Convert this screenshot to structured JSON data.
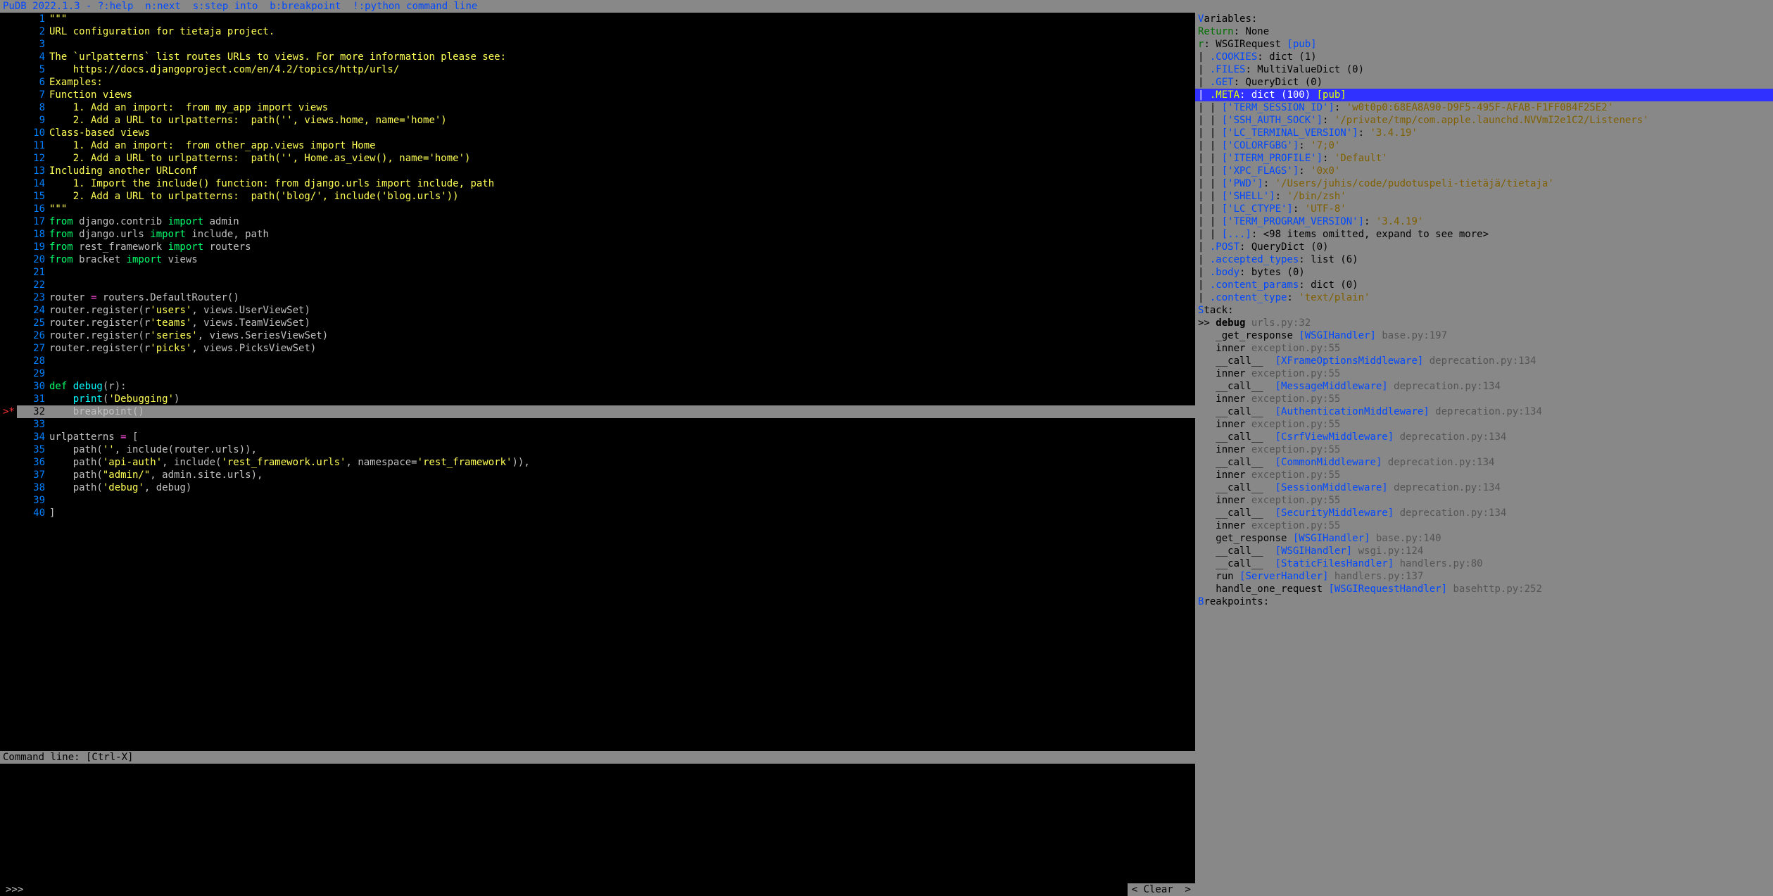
{
  "header": {
    "title": "PuDB 2022.1.3 - ",
    "hints": "?:help  n:next  s:step into  b:breakpoint  !:python command line"
  },
  "code": {
    "current_line": 32,
    "lines": [
      {
        "n": 1,
        "tokens": [
          {
            "c": "s-str",
            "t": "\"\"\""
          }
        ]
      },
      {
        "n": 2,
        "tokens": [
          {
            "c": "s-str",
            "t": "URL configuration for tietaja project."
          }
        ]
      },
      {
        "n": 3,
        "tokens": []
      },
      {
        "n": 4,
        "tokens": [
          {
            "c": "s-str",
            "t": "The `urlpatterns` list routes URLs to views. For more information please see:"
          }
        ]
      },
      {
        "n": 5,
        "tokens": [
          {
            "c": "s-str",
            "t": "    https://docs.djangoproject.com/en/4.2/topics/http/urls/"
          }
        ]
      },
      {
        "n": 6,
        "tokens": [
          {
            "c": "s-str",
            "t": "Examples:"
          }
        ]
      },
      {
        "n": 7,
        "tokens": [
          {
            "c": "s-str",
            "t": "Function views"
          }
        ]
      },
      {
        "n": 8,
        "tokens": [
          {
            "c": "s-str",
            "t": "    1. Add an import:  from my_app import views"
          }
        ]
      },
      {
        "n": 9,
        "tokens": [
          {
            "c": "s-str",
            "t": "    2. Add a URL to urlpatterns:  path('', views.home, name='home')"
          }
        ]
      },
      {
        "n": 10,
        "tokens": [
          {
            "c": "s-str",
            "t": "Class-based views"
          }
        ]
      },
      {
        "n": 11,
        "tokens": [
          {
            "c": "s-str",
            "t": "    1. Add an import:  from other_app.views import Home"
          }
        ]
      },
      {
        "n": 12,
        "tokens": [
          {
            "c": "s-str",
            "t": "    2. Add a URL to urlpatterns:  path('', Home.as_view(), name='home')"
          }
        ]
      },
      {
        "n": 13,
        "tokens": [
          {
            "c": "s-str",
            "t": "Including another URLconf"
          }
        ]
      },
      {
        "n": 14,
        "tokens": [
          {
            "c": "s-str",
            "t": "    1. Import the include() function: from django.urls import include, path"
          }
        ]
      },
      {
        "n": 15,
        "tokens": [
          {
            "c": "s-str",
            "t": "    2. Add a URL to urlpatterns:  path('blog/', include('blog.urls'))"
          }
        ]
      },
      {
        "n": 16,
        "tokens": [
          {
            "c": "s-str",
            "t": "\"\"\""
          }
        ]
      },
      {
        "n": 17,
        "tokens": [
          {
            "c": "s-kw",
            "t": "from"
          },
          {
            "c": "s-plain",
            "t": " django.contrib "
          },
          {
            "c": "s-kw",
            "t": "import"
          },
          {
            "c": "s-plain",
            "t": " admin"
          }
        ]
      },
      {
        "n": 18,
        "tokens": [
          {
            "c": "s-kw",
            "t": "from"
          },
          {
            "c": "s-plain",
            "t": " django.urls "
          },
          {
            "c": "s-kw",
            "t": "import"
          },
          {
            "c": "s-plain",
            "t": " include, path"
          }
        ]
      },
      {
        "n": 19,
        "tokens": [
          {
            "c": "s-kw",
            "t": "from"
          },
          {
            "c": "s-plain",
            "t": " rest_framework "
          },
          {
            "c": "s-kw",
            "t": "import"
          },
          {
            "c": "s-plain",
            "t": " routers"
          }
        ]
      },
      {
        "n": 20,
        "tokens": [
          {
            "c": "s-kw",
            "t": "from"
          },
          {
            "c": "s-plain",
            "t": " bracket "
          },
          {
            "c": "s-kw",
            "t": "import"
          },
          {
            "c": "s-plain",
            "t": " views"
          }
        ]
      },
      {
        "n": 21,
        "tokens": []
      },
      {
        "n": 22,
        "tokens": []
      },
      {
        "n": 23,
        "tokens": [
          {
            "c": "s-plain",
            "t": "router "
          },
          {
            "c": "s-op",
            "t": "="
          },
          {
            "c": "s-plain",
            "t": " routers.DefaultRouter()"
          }
        ]
      },
      {
        "n": 24,
        "tokens": [
          {
            "c": "s-plain",
            "t": "router.register(r"
          },
          {
            "c": "s-str2",
            "t": "'users'"
          },
          {
            "c": "s-plain",
            "t": ", views.UserViewSet)"
          }
        ]
      },
      {
        "n": 25,
        "tokens": [
          {
            "c": "s-plain",
            "t": "router.register(r"
          },
          {
            "c": "s-str2",
            "t": "'teams'"
          },
          {
            "c": "s-plain",
            "t": ", views.TeamViewSet)"
          }
        ]
      },
      {
        "n": 26,
        "tokens": [
          {
            "c": "s-plain",
            "t": "router.register(r"
          },
          {
            "c": "s-str2",
            "t": "'series'"
          },
          {
            "c": "s-plain",
            "t": ", views.SeriesViewSet)"
          }
        ]
      },
      {
        "n": 27,
        "tokens": [
          {
            "c": "s-plain",
            "t": "router.register(r"
          },
          {
            "c": "s-str2",
            "t": "'picks'"
          },
          {
            "c": "s-plain",
            "t": ", views.PicksViewSet)"
          }
        ]
      },
      {
        "n": 28,
        "tokens": []
      },
      {
        "n": 29,
        "tokens": []
      },
      {
        "n": 30,
        "tokens": [
          {
            "c": "s-kw",
            "t": "def "
          },
          {
            "c": "s-def",
            "t": "debug"
          },
          {
            "c": "s-plain",
            "t": "(r):"
          }
        ]
      },
      {
        "n": 31,
        "tokens": [
          {
            "c": "s-plain",
            "t": "    "
          },
          {
            "c": "s-def",
            "t": "print"
          },
          {
            "c": "s-plain",
            "t": "("
          },
          {
            "c": "s-str2",
            "t": "'Debugging'"
          },
          {
            "c": "s-plain",
            "t": ")"
          }
        ]
      },
      {
        "n": 32,
        "tokens": [
          {
            "c": "s-plain",
            "t": "    breakpoint()"
          }
        ],
        "marker": ">*"
      },
      {
        "n": 33,
        "tokens": []
      },
      {
        "n": 34,
        "tokens": [
          {
            "c": "s-plain",
            "t": "urlpatterns "
          },
          {
            "c": "s-op",
            "t": "="
          },
          {
            "c": "s-plain",
            "t": " ["
          }
        ]
      },
      {
        "n": 35,
        "tokens": [
          {
            "c": "s-plain",
            "t": "    path("
          },
          {
            "c": "s-str2",
            "t": "''"
          },
          {
            "c": "s-plain",
            "t": ", include(router.urls)),"
          }
        ]
      },
      {
        "n": 36,
        "tokens": [
          {
            "c": "s-plain",
            "t": "    path("
          },
          {
            "c": "s-str2",
            "t": "'api-auth'"
          },
          {
            "c": "s-plain",
            "t": ", include("
          },
          {
            "c": "s-str2",
            "t": "'rest_framework.urls'"
          },
          {
            "c": "s-plain",
            "t": ", namespace="
          },
          {
            "c": "s-str2",
            "t": "'rest_framework'"
          },
          {
            "c": "s-plain",
            "t": ")),"
          }
        ]
      },
      {
        "n": 37,
        "tokens": [
          {
            "c": "s-plain",
            "t": "    path("
          },
          {
            "c": "s-str2",
            "t": "\"admin/\""
          },
          {
            "c": "s-plain",
            "t": ", admin.site.urls),"
          }
        ]
      },
      {
        "n": 38,
        "tokens": [
          {
            "c": "s-plain",
            "t": "    path("
          },
          {
            "c": "s-str2",
            "t": "'debug'"
          },
          {
            "c": "s-plain",
            "t": ", debug)"
          }
        ]
      },
      {
        "n": 39,
        "tokens": []
      },
      {
        "n": 40,
        "tokens": [
          {
            "c": "s-plain",
            "t": "]"
          }
        ]
      }
    ]
  },
  "cmd": {
    "label": "Command line: [Ctrl-X]",
    "prompt": ">>>",
    "clear": "< Clear  >"
  },
  "variables": {
    "header_first": "V",
    "header_rest": "ariables:",
    "lines": [
      {
        "pre": "",
        "key": "Return",
        "kc": "var-key-g",
        "sep": ": ",
        "val": "None",
        "vc": "var-val"
      },
      {
        "pre": "",
        "key": "r",
        "kc": "var-key-g",
        "sep": ": ",
        "val": "WSGIRequest ",
        "vc": "var-val",
        "suffix": "[pub]",
        "sc": "var-pub"
      },
      {
        "pre": "| ",
        "key": ".COOKIES",
        "kc": "var-key",
        "sep": ": ",
        "val": "dict (1)",
        "vc": "var-val"
      },
      {
        "pre": "| ",
        "key": ".FILES",
        "kc": "var-key",
        "sep": ": ",
        "val": "MultiValueDict (0)",
        "vc": "var-val"
      },
      {
        "pre": "| ",
        "key": ".GET",
        "kc": "var-key",
        "sep": ": ",
        "val": "QueryDict (0)",
        "vc": "var-val"
      },
      {
        "pre": "| ",
        "key": ".META",
        "kc": "var-key",
        "sep": ": ",
        "val": "dict (100) ",
        "vc": "var-val",
        "suffix": "[pub]",
        "sc": "var-pub",
        "hi": true
      },
      {
        "pre": "| | ",
        "key": "['TERM_SESSION_ID']",
        "kc": "var-key",
        "sep": ": ",
        "val": "'w0t0p0:68EA8A90-D9F5-495F-AFAB-F1FF0B4F25E2'",
        "vc": "var-val-y"
      },
      {
        "pre": "| | ",
        "key": "['SSH_AUTH_SOCK']",
        "kc": "var-key",
        "sep": ": ",
        "val": "'/private/tmp/com.apple.launchd.NVVmI2e1C2/Listeners'",
        "vc": "var-val-y"
      },
      {
        "pre": "| | ",
        "key": "['LC_TERMINAL_VERSION']",
        "kc": "var-key",
        "sep": ": ",
        "val": "'3.4.19'",
        "vc": "var-val-y"
      },
      {
        "pre": "| | ",
        "key": "['COLORFGBG']",
        "kc": "var-key",
        "sep": ": ",
        "val": "'7;0'",
        "vc": "var-val-y"
      },
      {
        "pre": "| | ",
        "key": "['ITERM_PROFILE']",
        "kc": "var-key",
        "sep": ": ",
        "val": "'Default'",
        "vc": "var-val-y"
      },
      {
        "pre": "| | ",
        "key": "['XPC_FLAGS']",
        "kc": "var-key",
        "sep": ": ",
        "val": "'0x0'",
        "vc": "var-val-y"
      },
      {
        "pre": "| | ",
        "key": "['PWD']",
        "kc": "var-key",
        "sep": ": ",
        "val": "'/Users/juhis/code/pudotuspeli-tietäjä/tietaja'",
        "vc": "var-val-y"
      },
      {
        "pre": "| | ",
        "key": "['SHELL']",
        "kc": "var-key",
        "sep": ": ",
        "val": "'/bin/zsh'",
        "vc": "var-val-y"
      },
      {
        "pre": "| | ",
        "key": "['LC_CTYPE']",
        "kc": "var-key",
        "sep": ": ",
        "val": "'UTF-8'",
        "vc": "var-val-y"
      },
      {
        "pre": "| | ",
        "key": "['TERM_PROGRAM_VERSION']",
        "kc": "var-key",
        "sep": ": ",
        "val": "'3.4.19'",
        "vc": "var-val-y"
      },
      {
        "pre": "| | ",
        "key": "[...]",
        "kc": "var-key",
        "sep": ": ",
        "val": "<98 items omitted, expand to see more>",
        "vc": "var-val"
      },
      {
        "pre": "| ",
        "key": ".POST",
        "kc": "var-key",
        "sep": ": ",
        "val": "QueryDict (0)",
        "vc": "var-val"
      },
      {
        "pre": "| ",
        "key": ".accepted_types",
        "kc": "var-key",
        "sep": ": ",
        "val": "list (6)",
        "vc": "var-val"
      },
      {
        "pre": "| ",
        "key": ".body",
        "kc": "var-key",
        "sep": ": ",
        "val": "bytes (0)",
        "vc": "var-val"
      },
      {
        "pre": "| ",
        "key": ".content_params",
        "kc": "var-key",
        "sep": ": ",
        "val": "dict (0)",
        "vc": "var-val"
      },
      {
        "pre": "| ",
        "key": ".content_type",
        "kc": "var-key",
        "sep": ": ",
        "val": "'text/plain'",
        "vc": "var-val-y"
      }
    ]
  },
  "stack": {
    "header_first": "S",
    "header_rest": "tack:",
    "lines": [
      {
        "cur": ">> ",
        "fn": "debug",
        "cls": "",
        "loc": " urls.py:32"
      },
      {
        "cur": "   ",
        "fn": "_get_response ",
        "cls": "[WSGIHandler]",
        "loc": " base.py:197"
      },
      {
        "cur": "   ",
        "fn": "inner ",
        "cls": "",
        "loc": "exception.py:55"
      },
      {
        "cur": "   ",
        "fn": "__call__  ",
        "cls": "[XFrameOptionsMiddleware]",
        "loc": " deprecation.py:134"
      },
      {
        "cur": "   ",
        "fn": "inner ",
        "cls": "",
        "loc": "exception.py:55"
      },
      {
        "cur": "   ",
        "fn": "__call__  ",
        "cls": "[MessageMiddleware]",
        "loc": " deprecation.py:134"
      },
      {
        "cur": "   ",
        "fn": "inner ",
        "cls": "",
        "loc": "exception.py:55"
      },
      {
        "cur": "   ",
        "fn": "__call__  ",
        "cls": "[AuthenticationMiddleware]",
        "loc": " deprecation.py:134"
      },
      {
        "cur": "   ",
        "fn": "inner ",
        "cls": "",
        "loc": "exception.py:55"
      },
      {
        "cur": "   ",
        "fn": "__call__  ",
        "cls": "[CsrfViewMiddleware]",
        "loc": " deprecation.py:134"
      },
      {
        "cur": "   ",
        "fn": "inner ",
        "cls": "",
        "loc": "exception.py:55"
      },
      {
        "cur": "   ",
        "fn": "__call__  ",
        "cls": "[CommonMiddleware]",
        "loc": " deprecation.py:134"
      },
      {
        "cur": "   ",
        "fn": "inner ",
        "cls": "",
        "loc": "exception.py:55"
      },
      {
        "cur": "   ",
        "fn": "__call__  ",
        "cls": "[SessionMiddleware]",
        "loc": " deprecation.py:134"
      },
      {
        "cur": "   ",
        "fn": "inner ",
        "cls": "",
        "loc": "exception.py:55"
      },
      {
        "cur": "   ",
        "fn": "__call__  ",
        "cls": "[SecurityMiddleware]",
        "loc": " deprecation.py:134"
      },
      {
        "cur": "   ",
        "fn": "inner ",
        "cls": "",
        "loc": "exception.py:55"
      },
      {
        "cur": "   ",
        "fn": "get_response ",
        "cls": "[WSGIHandler]",
        "loc": " base.py:140"
      },
      {
        "cur": "   ",
        "fn": "__call__  ",
        "cls": "[WSGIHandler]",
        "loc": " wsgi.py:124"
      },
      {
        "cur": "   ",
        "fn": "__call__  ",
        "cls": "[StaticFilesHandler]",
        "loc": " handlers.py:80"
      },
      {
        "cur": "   ",
        "fn": "run ",
        "cls": "[ServerHandler]",
        "loc": " handlers.py:137"
      },
      {
        "cur": "   ",
        "fn": "handle_one_request ",
        "cls": "[WSGIRequestHandler]",
        "loc": " basehttp.py:252"
      }
    ]
  },
  "breakpoints": {
    "header_first": "B",
    "header_rest": "reakpoints:"
  }
}
